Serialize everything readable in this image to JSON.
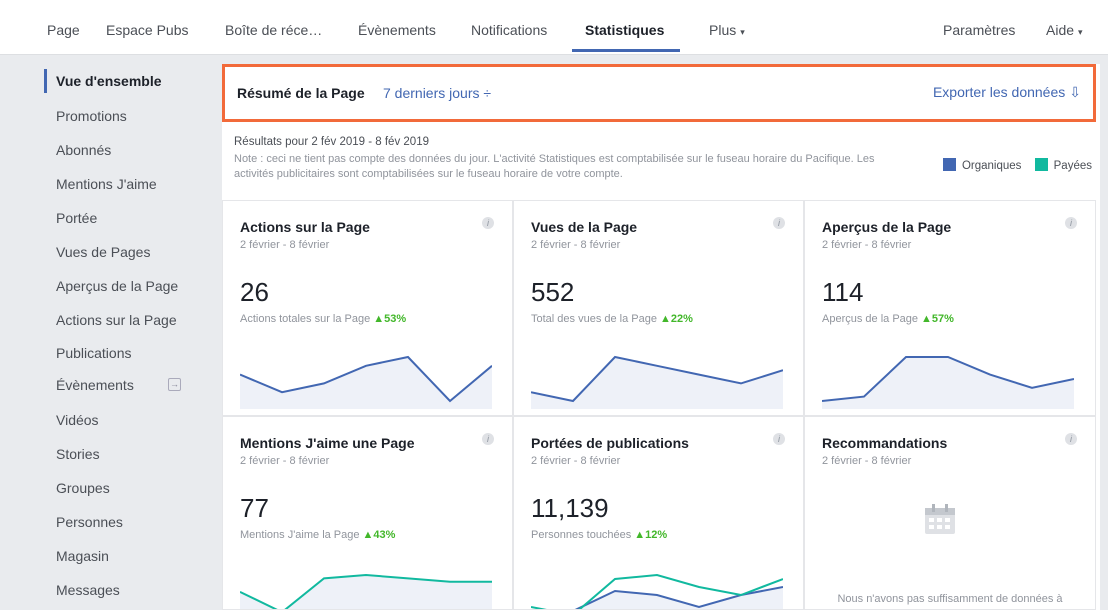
{
  "nav": {
    "items": [
      "Page",
      "Espace Pubs",
      "Boîte de réce…",
      "Évènements",
      "Notifications",
      "Statistiques",
      "Plus"
    ],
    "right": [
      "Paramètres",
      "Aide"
    ]
  },
  "sidebar": {
    "items": [
      "Vue d'ensemble",
      "Promotions",
      "Abonnés",
      "Mentions J'aime",
      "Portée",
      "Vues de Pages",
      "Aperçus de la Page",
      "Actions sur la Page",
      "Publications",
      "Évènements",
      "Vidéos",
      "Stories",
      "Groupes",
      "Personnes",
      "Magasin",
      "Messages"
    ]
  },
  "summary": {
    "title": "Résumé de la Page",
    "range": "7 derniers jours ÷",
    "export": "Exporter les données"
  },
  "results_line": "Résultats pour 2 fév 2019 - 8 fév 2019",
  "note": "Note : ceci ne tient pas compte des données du jour. L'activité Statistiques est comptabilisée sur le fuseau horaire du Pacifique. Les activités publicitaires sont comptabilisées sur le fuseau horaire de votre compte.",
  "legend": {
    "organic": "Organiques",
    "paid": "Payées",
    "organic_color": "#4267b2",
    "paid_color": "#11b99f"
  },
  "cards": [
    {
      "title": "Actions sur la Page",
      "date": "2 février - 8 février",
      "value": "26",
      "sub": "Actions totales sur la Page",
      "pct": "▲53%",
      "organic": [
        3,
        1,
        2,
        4,
        5,
        0,
        4
      ]
    },
    {
      "title": "Vues de la Page",
      "date": "2 février - 8 février",
      "value": "552",
      "sub": "Total des vues de la Page",
      "pct": "▲22%",
      "organic": [
        1,
        0,
        5,
        4,
        3,
        2,
        3.5
      ]
    },
    {
      "title": "Aperçus de la Page",
      "date": "2 février - 8 février",
      "value": "114",
      "sub": "Aperçus de la Page",
      "pct": "▲57%",
      "organic": [
        0,
        0.5,
        5,
        5,
        3,
        1.5,
        2.5
      ]
    },
    {
      "title": "Mentions J'aime une Page",
      "date": "2 février - 8 février",
      "value": "77",
      "sub": "Mentions J'aime la Page",
      "pct": "▲43%",
      "paid": [
        4,
        1,
        6,
        6.5,
        6,
        5.5,
        5.5
      ]
    },
    {
      "title": "Portées de publications",
      "date": "2 février - 8 février",
      "value": "11,139",
      "sub": "Personnes touchées",
      "pct": "▲12%",
      "organic": [
        1,
        1,
        3.5,
        3,
        1.5,
        3,
        4
      ],
      "paid": [
        1.5,
        0.5,
        5,
        5.5,
        4,
        3,
        5
      ]
    },
    {
      "title": "Recommandations",
      "date": "2 février - 8 février",
      "no_data": "Nous n'avons pas suffisamment de données à afficher pour la période"
    }
  ]
}
